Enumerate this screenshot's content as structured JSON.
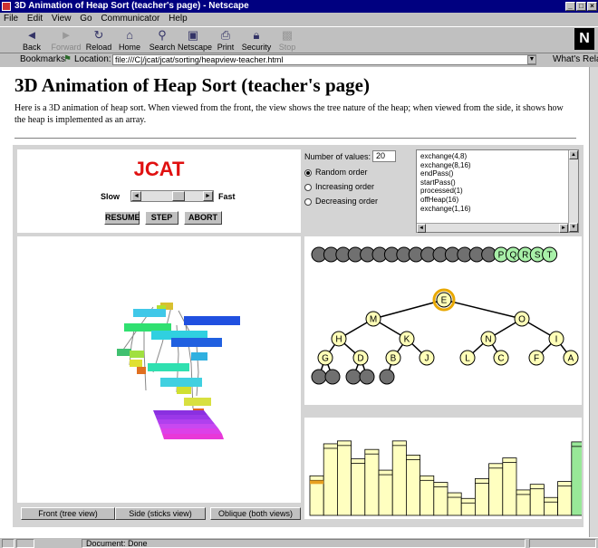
{
  "window": {
    "title": "3D Animation of Heap Sort (teacher's page) - Netscape"
  },
  "menu": [
    "File",
    "Edit",
    "View",
    "Go",
    "Communicator",
    "Help"
  ],
  "toolbar": {
    "back": "Back",
    "forward": "Forward",
    "reload": "Reload",
    "home": "Home",
    "search": "Search",
    "netscape": "Netscape",
    "print": "Print",
    "security": "Security",
    "stop": "Stop"
  },
  "location": {
    "bookmarks": "Bookmarks",
    "label": "Location:",
    "url": "file:///C|/jcat/jcat/sorting/heapview-teacher.html",
    "whats_related": "What's Related"
  },
  "page": {
    "heading": "3D Animation of Heap Sort (teacher's page)",
    "intro": "Here is a 3D animation of heap sort. When viewed from the front, the view shows the tree nature of the heap; when viewed from the side, it shows how the heap is implemented as an array."
  },
  "applet": {
    "logo": "JCAT",
    "slow": "Slow",
    "fast": "Fast",
    "resume": "RESUME",
    "step": "STEP",
    "abort": "ABORT",
    "num_values_label": "Number of values:",
    "num_values": "20",
    "order_options": [
      "Random order",
      "Increasing order",
      "Decreasing order"
    ],
    "selected_order": "Random order",
    "log_lines": [
      "exchange(4,8)",
      "exchange(8,16)",
      "endPass()",
      "startPass()",
      "processed(1)",
      "offHeap(16)",
      "exchange(1,16)"
    ],
    "view_buttons": [
      "Front (tree view)",
      "Side (sticks view)",
      "Oblique (both views)"
    ]
  },
  "array_row": {
    "gray_count": 15,
    "sorted_labels": [
      "P",
      "Q",
      "R",
      "S",
      "T"
    ]
  },
  "tree": {
    "root": "E",
    "level1": [
      "M",
      "O"
    ],
    "level2": [
      "H",
      "K",
      "N",
      "I"
    ],
    "level3": [
      "G",
      "D",
      "B",
      "J",
      "L",
      "C",
      "F",
      "A"
    ],
    "level4_gray_count": 4
  },
  "bars": {
    "heap_values": [
      0.42,
      0.76,
      0.79,
      0.6,
      0.7,
      0.48,
      0.79,
      0.64,
      0.42,
      0.35,
      0.24,
      0.18,
      0.39,
      0.55,
      0.61,
      0.27,
      0.33,
      0.19,
      0.36
    ],
    "sorted_values": [
      0.78,
      0.82,
      0.86,
      0.9,
      0.95
    ]
  },
  "colors": {
    "logo": "#e01010",
    "heap_bar": "#ffffc0",
    "sorted_bar": "#98e898",
    "heap_node": "#ffffb8",
    "sorted_node": "#a8f0a8",
    "gray_node": "#707070",
    "root_ring": "#e8a800"
  },
  "status": {
    "text": "Document: Done"
  }
}
